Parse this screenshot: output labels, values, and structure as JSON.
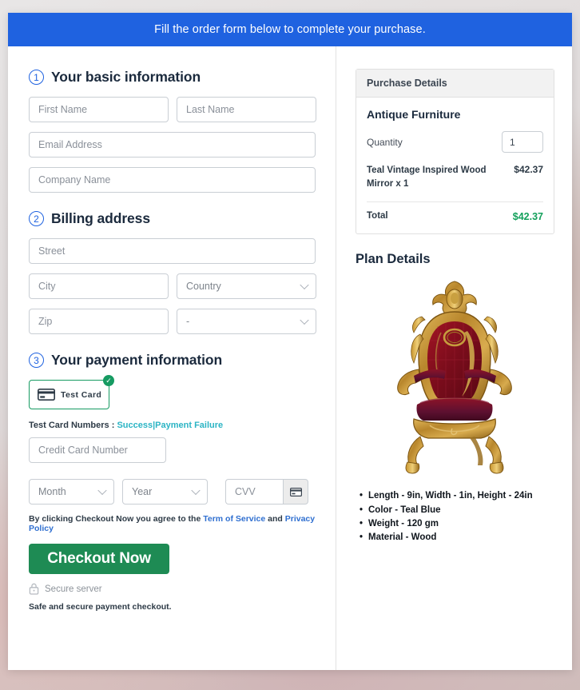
{
  "banner": {
    "text": "Fill the order form below to complete your purchase."
  },
  "colors": {
    "banner_blue": "#1f62e0",
    "accent_blue": "#2f6fd0",
    "success_green": "#1e8b54",
    "total_green": "#13a05b",
    "link_teal": "#2bb4c4",
    "tile_border_green": "#169b62"
  },
  "steps": [
    {
      "number": "1",
      "title": "Your basic information"
    },
    {
      "number": "2",
      "title": "Billing address"
    },
    {
      "number": "3",
      "title": "Your payment information"
    }
  ],
  "basic_info": {
    "first_name": {
      "placeholder": "First Name",
      "value": ""
    },
    "last_name": {
      "placeholder": "Last Name",
      "value": ""
    },
    "email": {
      "placeholder": "Email Address",
      "value": ""
    },
    "company": {
      "placeholder": "Company Name",
      "value": ""
    }
  },
  "billing": {
    "street": {
      "placeholder": "Street",
      "value": ""
    },
    "city": {
      "placeholder": "City",
      "value": ""
    },
    "country": {
      "placeholder": "Country",
      "value": "Country"
    },
    "zip": {
      "placeholder": "Zip",
      "value": ""
    },
    "state": {
      "placeholder": "-",
      "value": "-"
    }
  },
  "payment": {
    "tile_label": "Test  Card",
    "tile_selected": true,
    "test_prefix": "Test Card Numbers :",
    "test_success": "Success",
    "test_separator": "|",
    "test_failure": "Payment Failure",
    "card_number": {
      "placeholder": "Credit Card Number",
      "value": ""
    },
    "month": {
      "placeholder": "Month",
      "value": "Month"
    },
    "year": {
      "placeholder": "Year",
      "value": "Year"
    },
    "cvv": {
      "placeholder": "CVV",
      "value": ""
    }
  },
  "footer": {
    "terms_prefix": "By clicking Checkout Now you agree to the",
    "terms_link": "Term of Service",
    "terms_and": "and",
    "privacy_link": "Privacy Policy",
    "checkout_label": "Checkout Now",
    "secure_server": "Secure server",
    "safe_note": "Safe and secure payment checkout."
  },
  "purchase": {
    "panel_title": "Purchase Details",
    "product_name": "Antique Furniture",
    "quantity_label": "Quantity",
    "quantity_value": "1",
    "line_description": "Teal Vintage Inspired Wood Mirror x 1",
    "line_amount": "$42.37",
    "total_label": "Total",
    "total_amount": "$42.37"
  },
  "plan": {
    "title": "Plan Details",
    "image_alt": "antique-gilded-throne-chair",
    "specs": [
      "Length - 9in, Width - 1in, Height - 24in",
      "Color - Teal Blue",
      "Weight - 120 gm",
      "Material - Wood"
    ]
  }
}
